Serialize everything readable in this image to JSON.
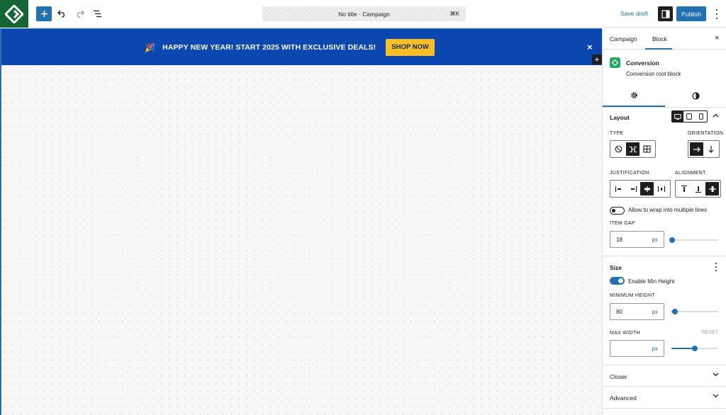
{
  "toolbar": {
    "command_title": "No title · Campaign",
    "command_shortcut": "⌘K",
    "save_draft": "Save draft",
    "publish": "Publish"
  },
  "banner": {
    "emoji": "🎉",
    "message": "HAPPY NEW YEAR! START 2025 WITH EXCLUSIVE DEALS!",
    "cta": "SHOP NOW",
    "close": "×",
    "add": "+",
    "background": "#0b47b0",
    "cta_color": "#fbbf24"
  },
  "sidebar": {
    "tabs": [
      "Campaign",
      "Block"
    ],
    "active_tab": "Block",
    "close": "×",
    "block": {
      "name": "Conversion",
      "description": "Conversion root block"
    },
    "layout": {
      "title": "Layout",
      "type_label": "TYPE",
      "orientation_label": "ORIENTATION",
      "justification_label": "JUSTIFICATION",
      "alignment_label": "ALIGNMENT",
      "wrap_label": "Allow to wrap into multiple lines",
      "wrap_enabled": false,
      "item_gap_label": "ITEM GAP",
      "item_gap_value": "18",
      "item_gap_unit": "px",
      "item_gap_slider": 0.02
    },
    "size": {
      "title": "Size",
      "min_height_toggle_label": "Enable Min Height",
      "min_height_enabled": true,
      "min_height_label": "MINIMUM HEIGHT",
      "min_height_value": "80",
      "min_height_unit": "px",
      "min_height_slider": 0.08,
      "max_width_label": "MAX WIDTH",
      "max_width_reset": "RESET",
      "max_width_value": "",
      "max_width_unit": "px",
      "max_width_slider": 0.5
    },
    "panels": [
      "Closer",
      "Advanced"
    ]
  },
  "colors": {
    "accent": "#2271b1",
    "dark": "#1e1e1e"
  }
}
